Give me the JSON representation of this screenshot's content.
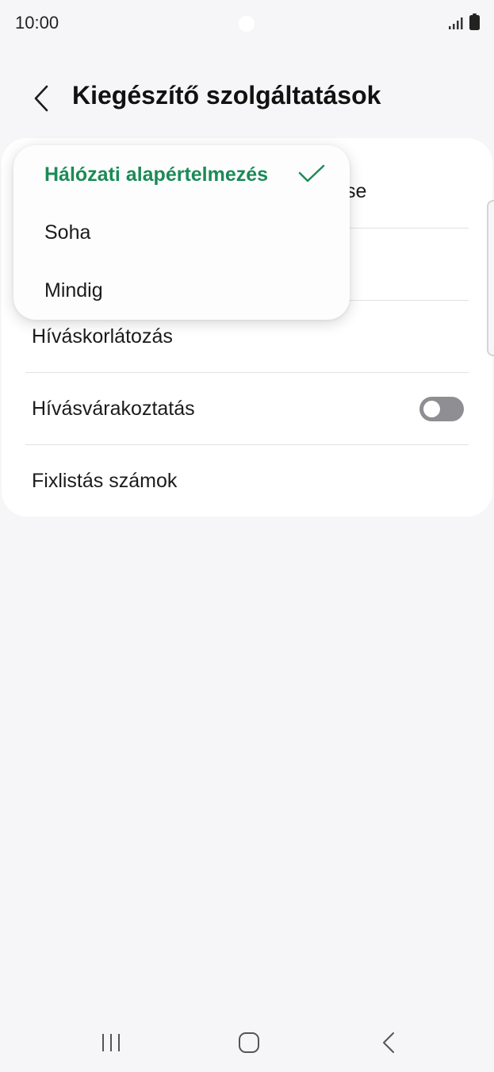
{
  "status_bar": {
    "time": "10:00",
    "signal_icon": "signal-icon",
    "battery_icon": "battery-icon"
  },
  "header": {
    "back_icon": "chevron-left-icon",
    "title": "Kiegészítő szolgáltatások"
  },
  "settings": {
    "rows": [
      {
        "label": "se",
        "partially_hidden": true
      },
      {
        "label": "",
        "partially_hidden": true
      },
      {
        "label": "Híváskorlátozás"
      },
      {
        "label": "Hívásvárakoztatás",
        "toggle": false
      },
      {
        "label": "Fixlistás számok"
      }
    ]
  },
  "dropdown": {
    "options": [
      {
        "label": "Hálózati alapértelmezés",
        "selected": true
      },
      {
        "label": "Soha",
        "selected": false
      },
      {
        "label": "Mindig",
        "selected": false
      }
    ],
    "accent_color": "#1c8a57"
  },
  "nav_bar": {
    "recents_icon": "recents-icon",
    "home_icon": "home-icon",
    "back_icon": "back-icon"
  }
}
